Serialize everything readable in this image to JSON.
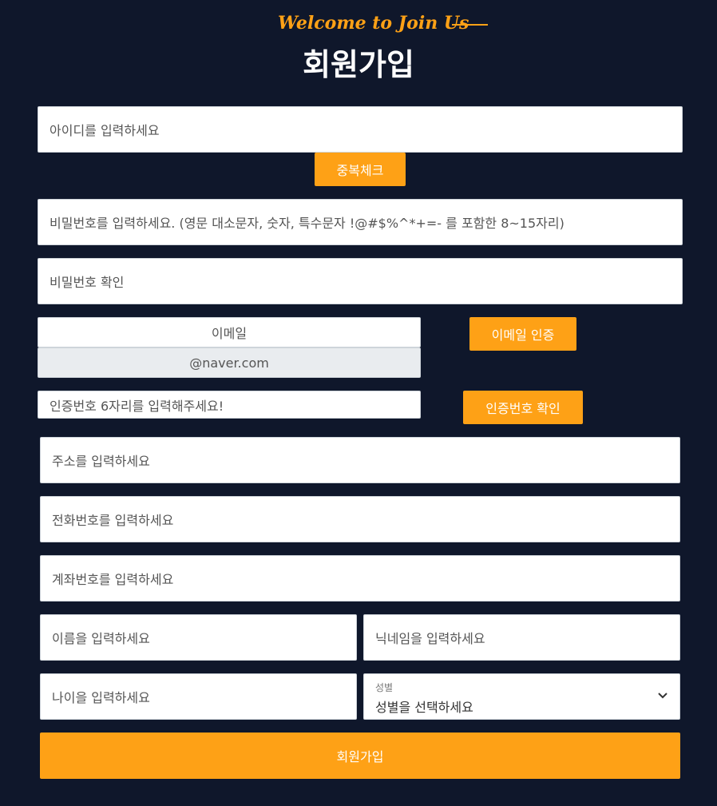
{
  "header": {
    "welcome": "Welcome to Join Us",
    "title": "회원가입"
  },
  "form": {
    "id_placeholder": "아이디를 입력하세요",
    "dup_check_label": "중복체크",
    "password_placeholder": "비밀번호를 입력하세요. (영문 대소문자, 숫자, 특수문자 !@#$%^*+=- 를 포함한 8~15자리)",
    "password_confirm_placeholder": "비밀번호 확인",
    "email_placeholder": "이메일",
    "email_domain": "@naver.com",
    "email_verify_label": "이메일 인증",
    "code_placeholder": "인증번호 6자리를 입력해주세요!",
    "code_confirm_label": "인증번호 확인",
    "address_placeholder": "주소를 입력하세요",
    "phone_placeholder": "전화번호를 입력하세요",
    "account_placeholder": "계좌번호를 입력하세요",
    "name_placeholder": "이름을 입력하세요",
    "nickname_placeholder": "닉네임을 입력하세요",
    "age_placeholder": "나이을 입력하세요",
    "gender_label": "성별",
    "gender_value": "성별을 선택하세요",
    "submit_label": "회원가입"
  },
  "colors": {
    "background": "#0f172b",
    "accent": "#fea116",
    "input_bg": "#ffffff",
    "readonly_bg": "#e9ecef"
  },
  "icons": {
    "select_chevron": "chevron-down-icon"
  }
}
